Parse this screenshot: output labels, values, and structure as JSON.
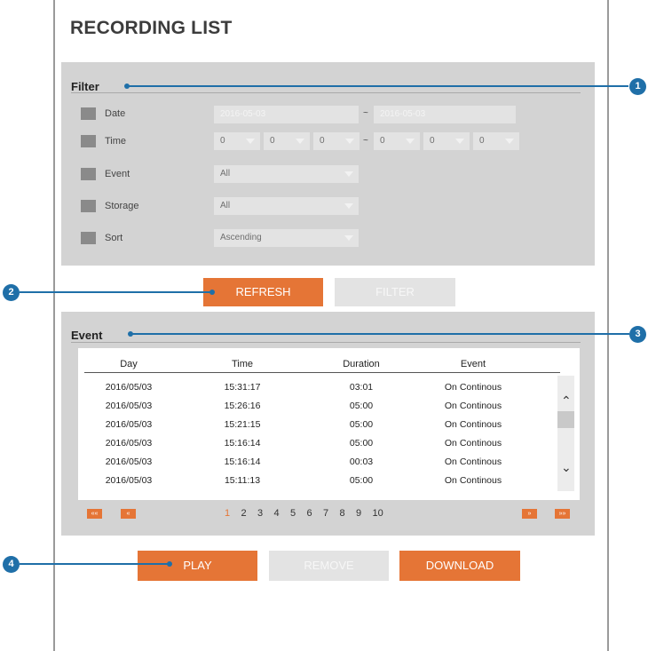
{
  "title": "RECORDING LIST",
  "filter": {
    "label": "Filter",
    "date": {
      "label": "Date",
      "from": "2016-05-03",
      "sep": "~",
      "to": "2016-05-03"
    },
    "time": {
      "label": "Time",
      "from": [
        "0",
        "0",
        "0"
      ],
      "sep": "~",
      "to": [
        "0",
        "0",
        "0"
      ]
    },
    "event": {
      "label": "Event",
      "value": "All"
    },
    "storage": {
      "label": "Storage",
      "value": "All"
    },
    "sort": {
      "label": "Sort",
      "value": "Ascending"
    }
  },
  "buttons": {
    "refresh": "REFRESH",
    "filter": "FILTER",
    "play": "PLAY",
    "remove": "REMOVE",
    "download": "DOWNLOAD"
  },
  "event_section": {
    "label": "Event",
    "columns": [
      "Day",
      "Time",
      "Duration",
      "Event"
    ],
    "rows": [
      [
        "2016/05/03",
        "15:31:17",
        "03:01",
        "On Continous"
      ],
      [
        "2016/05/03",
        "15:26:16",
        "05:00",
        "On Continous"
      ],
      [
        "2016/05/03",
        "15:21:15",
        "05:00",
        "On Continous"
      ],
      [
        "2016/05/03",
        "15:16:14",
        "05:00",
        "On Continous"
      ],
      [
        "2016/05/03",
        "15:16:14",
        "00:03",
        "On Continous"
      ],
      [
        "2016/05/03",
        "15:11:13",
        "05:00",
        "On Continous"
      ]
    ]
  },
  "pagination": {
    "first": "««",
    "prev": "«",
    "pages": [
      "1",
      "2",
      "3",
      "4",
      "5",
      "6",
      "7",
      "8",
      "9",
      "10"
    ],
    "current": "1",
    "next": "»",
    "last": "»»"
  },
  "callouts": [
    "1",
    "2",
    "3",
    "4"
  ],
  "colors": {
    "accent": "#e57536",
    "callout": "#1f6fa8",
    "panel": "#d3d3d3"
  }
}
